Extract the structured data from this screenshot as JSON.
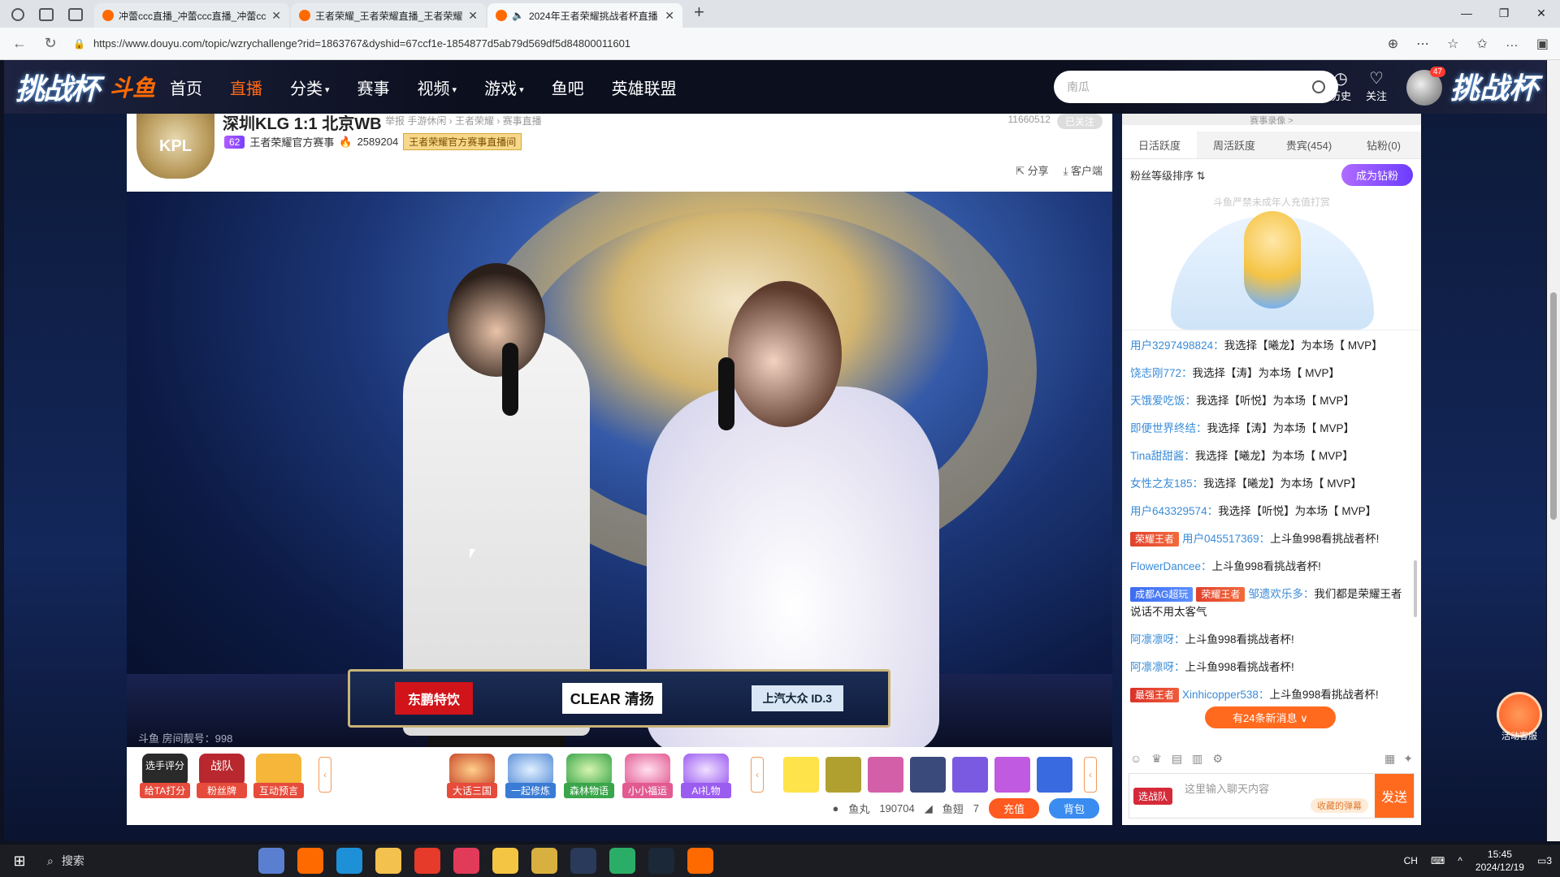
{
  "browser": {
    "tabs": [
      {
        "title": "冲蕾ccc直播_冲蕾ccc直播_冲蕾ccc"
      },
      {
        "title": "王者荣耀_王者荣耀直播_王者荣耀"
      },
      {
        "title": "2024年王者荣耀挑战者杯直播"
      }
    ],
    "url": "https://www.douyu.com/topic/wzrychallenge?rid=1863767&dyshid=67ccf1e-1854877d5ab79d569df5d84800011601"
  },
  "header": {
    "logo_left": "挑战杯",
    "logo_brand": "斗鱼",
    "nav": [
      "首页",
      "直播",
      "分类",
      "赛事",
      "视频",
      "游戏",
      "鱼吧",
      "英雄联盟"
    ],
    "search_placeholder": "南瓜",
    "history": "历史",
    "follow": "关注",
    "avatar_badge": "47",
    "logo_right": "挑战杯"
  },
  "room": {
    "logo": "KPL",
    "title": "深圳KLG 1:1 北京WB",
    "breadcrumb": "举报   手游休闲 › 王者荣耀 › 赛事直播",
    "level": "62",
    "owner": "王者荣耀官方赛事",
    "heat": "2589204",
    "official_badge": "王者荣耀官方赛事直播间",
    "viewer_count": "11660512",
    "follow_pill": "已关注",
    "share": "分享",
    "client": "客户端"
  },
  "video": {
    "sponsors": [
      "东鹏特饮",
      "CLEAR 清扬",
      "上汽大众 ID.3"
    ],
    "room_number": "斗鱼 房间靓号：998"
  },
  "gifts": {
    "left": [
      {
        "label": "给TA打分",
        "title": "选手评分",
        "color": "red"
      },
      {
        "label": "粉丝牌",
        "title": "战队",
        "color": "red"
      },
      {
        "label": "互动预言",
        "title": "",
        "color": "red"
      }
    ],
    "middle": [
      {
        "label": "大话三国",
        "color": "red"
      },
      {
        "label": "一起修炼",
        "color": "blue"
      },
      {
        "label": "森林物语",
        "color": "green"
      },
      {
        "label": "小小福运",
        "color": "pink"
      },
      {
        "label": "AI礼物",
        "color": "purple"
      }
    ],
    "fishball_label": "鱼丸",
    "fishball": "190704",
    "fin_label": "鱼翅",
    "fin": "7",
    "charge": "充值",
    "bag": "背包"
  },
  "side": {
    "top_hint": "赛事录像 >",
    "rank_tabs": [
      "日活跃度",
      "周活跃度",
      "贵宾(454)",
      "钻粉(0)"
    ],
    "fan_sort": "粉丝等级排序 ⇅",
    "become_fan": "成为钻粉",
    "notice": "斗鱼严禁未成年人充值打赏",
    "messages": [
      {
        "tags": [],
        "name": "用户3297498824：",
        "text": "我选择【曦龙】为本场【 MVP】"
      },
      {
        "tags": [],
        "name": "饶志刚772：",
        "text": "我选择【涛】为本场【 MVP】"
      },
      {
        "tags": [],
        "name": "天饿爱吃饭：",
        "text": "我选择【听悦】为本场【 MVP】"
      },
      {
        "tags": [],
        "name": "即便世界终结：",
        "text": "我选择【涛】为本场【 MVP】"
      },
      {
        "tags": [],
        "name": "Tina甜甜酱：",
        "text": "我选择【曦龙】为本场【 MVP】"
      },
      {
        "tags": [],
        "name": "女性之友185：",
        "text": "我选择【曦龙】为本场【 MVP】"
      },
      {
        "tags": [],
        "name": "用户643329574：",
        "text": "我选择【听悦】为本场【 MVP】"
      },
      {
        "tags": [
          {
            "t": "荣耀王者",
            "c": "king"
          }
        ],
        "name": "用户045517369：",
        "text": "上斗鱼998看挑战者杯!"
      },
      {
        "tags": [],
        "name": "FlowerDancee：",
        "text": "上斗鱼998看挑战者杯!"
      },
      {
        "tags": [
          {
            "t": "成都AG超玩",
            "c": "team"
          },
          {
            "t": "荣耀王者",
            "c": "king"
          }
        ],
        "name": "邹遗欢乐多：",
        "text": "我们都是荣耀王者 说话不用太客气"
      },
      {
        "tags": [],
        "name": "阿凛凛呀：",
        "text": "上斗鱼998看挑战者杯!"
      },
      {
        "tags": [],
        "name": "阿凛凛呀：",
        "text": "上斗鱼998看挑战者杯!"
      },
      {
        "tags": [
          {
            "t": "最强王者",
            "c": "best"
          }
        ],
        "name": "Xinhicopper538：",
        "text": "上斗鱼998看挑战者杯!"
      }
    ],
    "new_messages": "有24条新消息 ∨",
    "team_btn": "选战队",
    "input_placeholder": "这里输入聊天内容",
    "fav_danmu": "收藏的弹幕",
    "send": "发送"
  },
  "float_help": "活动客服",
  "taskbar": {
    "search": "搜索",
    "ime": "CH",
    "time": "15:45",
    "date": "2024/12/19",
    "notif": "3"
  }
}
